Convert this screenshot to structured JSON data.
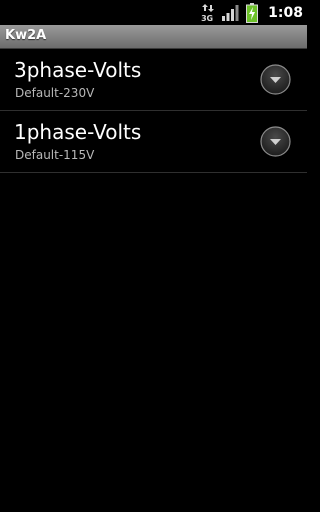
{
  "status_bar": {
    "network_label": "3G",
    "time": "1:08",
    "icons": [
      "data-arrows-icon",
      "signal-bars-icon",
      "battery-charging-icon"
    ]
  },
  "title_bar": {
    "title": "Kw2A"
  },
  "preferences": [
    {
      "title": "3phase-Volts",
      "summary": "Default-230V",
      "icon": "chevron-down-icon"
    },
    {
      "title": "1phase-Volts",
      "summary": "Default-115V",
      "icon": "chevron-down-icon"
    }
  ],
  "colors": {
    "background": "#000000",
    "titlebar": "#8a8a8a",
    "battery": "#6dc12a"
  }
}
